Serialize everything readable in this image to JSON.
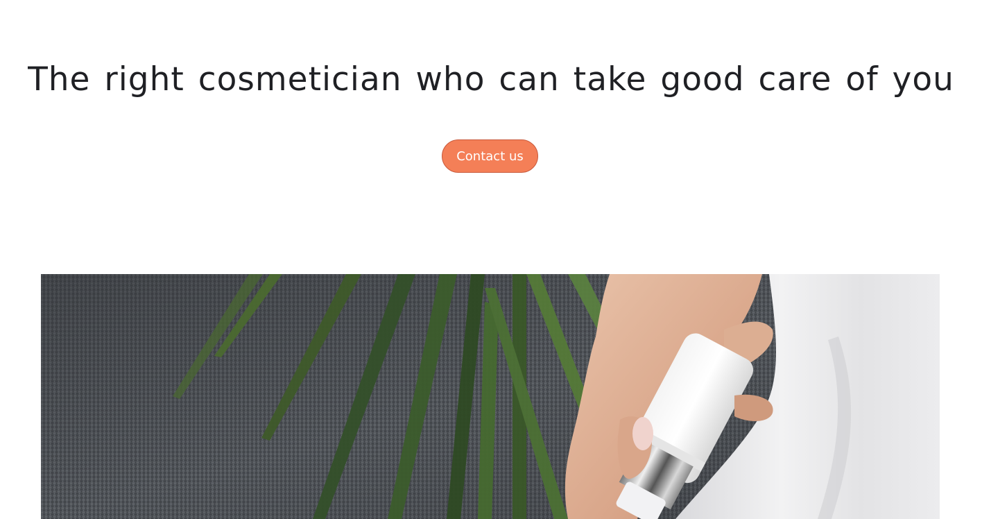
{
  "hero": {
    "title": "The right cosmetician who can take good care of you",
    "contact_button_label": "Contact us"
  },
  "image": {
    "subject": "hand-holding-cosmetic-bottle-photo"
  },
  "colors": {
    "button_bg": "#f47f57",
    "button_border": "#c8583a",
    "title_text": "#1f2024",
    "page_bg": "#ffffff"
  }
}
